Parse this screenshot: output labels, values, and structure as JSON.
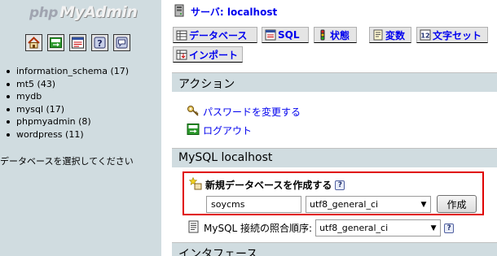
{
  "left": {
    "logo": {
      "part1": "php",
      "part2": "MyAdmin"
    },
    "icons": [
      "home-icon",
      "logout-icon",
      "sql-query-icon",
      "help-icon",
      "docs-icon"
    ],
    "databases": [
      "information_schema (17)",
      "mt5 (43)",
      "mydb",
      "mysql (17)",
      "phpmyadmin (8)",
      "wordpress (11)"
    ],
    "hint": "データベースを選択してください"
  },
  "header": {
    "server_label": "サーバ: localhost"
  },
  "tabs": [
    {
      "label": "データベース",
      "icon": "database-icon"
    },
    {
      "label": "SQL",
      "icon": "sql-icon"
    },
    {
      "label": "状態",
      "icon": "status-icon"
    },
    {
      "label": "変数",
      "icon": "variables-icon"
    },
    {
      "label": "文字セット",
      "icon": "charset-icon"
    },
    {
      "label": "インポート",
      "icon": "import-icon"
    }
  ],
  "actions": {
    "title": "アクション",
    "change_password": "パスワードを変更する",
    "logout": "ログアウト"
  },
  "mysql": {
    "title": "MySQL localhost",
    "create_db_label": "新規データベースを作成する",
    "db_name_value": "soycms",
    "collation_value": "utf8_general_ci",
    "create_button": "作成",
    "connection_collation_label": "MySQL 接続の照合順序:",
    "connection_collation_value": "utf8_general_ci"
  },
  "interface": {
    "title": "インタフェース"
  }
}
